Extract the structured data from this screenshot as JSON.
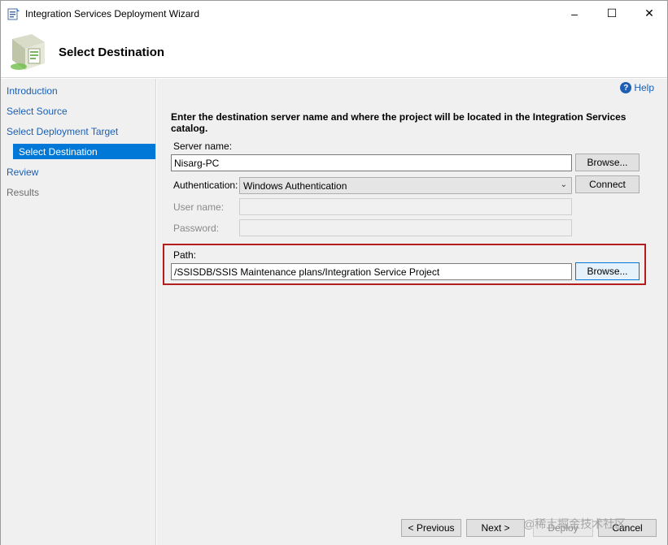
{
  "window": {
    "title": "Integration Services Deployment Wizard",
    "minimize": "–",
    "maximize": "☐",
    "close": "✕"
  },
  "header": {
    "title": "Select Destination"
  },
  "nav": {
    "items": [
      {
        "label": "Introduction",
        "state": "link"
      },
      {
        "label": "Select Source",
        "state": "link"
      },
      {
        "label": "Select Deployment Target",
        "state": "link"
      },
      {
        "label": "Select Destination",
        "state": "selected"
      },
      {
        "label": "Review",
        "state": "link"
      },
      {
        "label": "Results",
        "state": "disabled"
      }
    ]
  },
  "help": {
    "label": "Help",
    "icon": "?"
  },
  "form": {
    "instructions": "Enter the destination server name and where the project will be located in the Integration Services catalog.",
    "server_label": "Server name:",
    "server_value": "Nisarg-PC",
    "server_browse": "Browse...",
    "auth_label": "Authentication:",
    "auth_value": "Windows Authentication",
    "connect": "Connect",
    "username_label": "User name:",
    "username_value": "",
    "password_label": "Password:",
    "password_value": "",
    "path_label": "Path:",
    "path_value": "/SSISDB/SSIS Maintenance plans/Integration Service Project",
    "path_browse": "Browse..."
  },
  "footer": {
    "previous": "< Previous",
    "next": "Next >",
    "deploy": "Deploy",
    "cancel": "Cancel",
    "watermark": "@稀土掘金技术社区"
  },
  "colors": {
    "accent": "#0078d7",
    "highlight_border": "#b41e1e",
    "link": "#1a5fb4"
  }
}
